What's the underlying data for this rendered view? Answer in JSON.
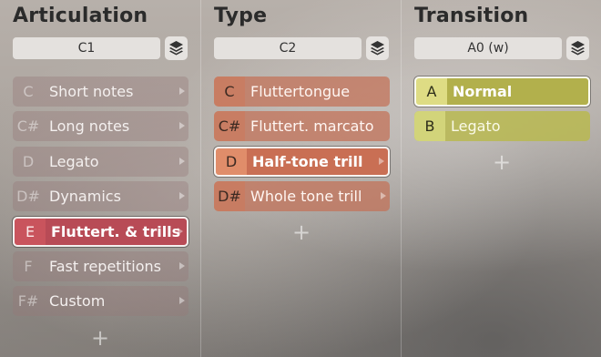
{
  "columns": [
    {
      "title": "Articulation",
      "selector_value": "C1",
      "items": [
        {
          "key": "C",
          "label": "Short notes"
        },
        {
          "key": "C#",
          "label": "Long notes"
        },
        {
          "key": "D",
          "label": "Legato"
        },
        {
          "key": "D#",
          "label": "Dynamics"
        },
        {
          "key": "E",
          "label": "Fluttert. & trills"
        },
        {
          "key": "F",
          "label": "Fast repetitions"
        },
        {
          "key": "F#",
          "label": "Custom"
        }
      ],
      "selected_index": 4,
      "add_label": "+"
    },
    {
      "title": "Type",
      "selector_value": "C2",
      "items": [
        {
          "key": "C",
          "label": "Fluttertongue"
        },
        {
          "key": "C#",
          "label": "Fluttert. marcato"
        },
        {
          "key": "D",
          "label": "Half-tone trill"
        },
        {
          "key": "D#",
          "label": "Whole tone trill"
        }
      ],
      "selected_index": 2,
      "add_label": "+"
    },
    {
      "title": "Transition",
      "selector_value": "A0 (w)",
      "items": [
        {
          "key": "A",
          "label": "Normal"
        },
        {
          "key": "B",
          "label": "Legato"
        }
      ],
      "selected_index": 0,
      "add_label": "+"
    }
  ],
  "icons": {
    "stack": "layers-icon",
    "arrow": "chevron-right-icon",
    "add": "plus-icon"
  },
  "colors": {
    "articulation_accent": "#c9545d",
    "type_accent": "#c96f54",
    "transition_accent": "#b2b04c"
  }
}
